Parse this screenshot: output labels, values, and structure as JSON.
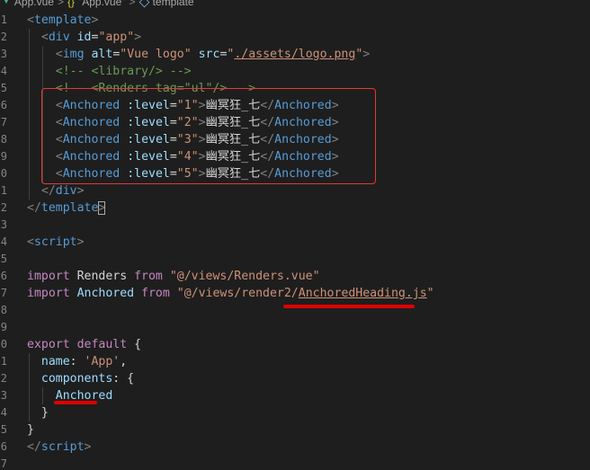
{
  "breadcrumb": {
    "file_icon": "vue-file-icon",
    "file": "App.vue",
    "separator1": ">",
    "braces_icon": "{}",
    "component": "\"App.vue\"",
    "separator2": ">",
    "symbol_icon": "cube-icon",
    "section": "template"
  },
  "colors": {
    "background": "#1e1e1e",
    "tag": "#569cd6",
    "attribute": "#9cdcfe",
    "string": "#ce9178",
    "comment": "#6a9955",
    "keyword": "#c586c0",
    "annotation_red": "#e53935"
  },
  "gutter": {
    "line_numbers": [
      "1",
      "2",
      "3",
      "4",
      "5",
      "6",
      "7",
      "8",
      "9",
      "0",
      "1",
      "2",
      "3",
      "4",
      "5",
      "6",
      "7",
      "8",
      "9",
      "0",
      "1",
      "2",
      "3",
      "4",
      "5",
      "6",
      "7"
    ]
  },
  "code": {
    "l1": {
      "open": "<",
      "tag": "template",
      "close": ">"
    },
    "l2": {
      "open": "<",
      "tag": "div",
      "attr": " id",
      "eq": "=",
      "val": "\"app\"",
      "close": ">"
    },
    "l3": {
      "open": "<",
      "tag": "img",
      "attr1": " alt",
      "eq1": "=",
      "val1": "\"Vue logo\"",
      "attr2": " src",
      "eq2": "=",
      "q1": "\"",
      "path": "./assets/logo.png",
      "q2": "\"",
      "close": ">"
    },
    "l4": {
      "comment": "<!-- <library/> -->"
    },
    "l5": {
      "comment": "<!-- <Renders tag=\"ul\"/> -->"
    },
    "anchored_lines": [
      {
        "open": "<",
        "tag": "Anchored",
        "attr": " :level",
        "eq": "=",
        "val": "\"1\"",
        "close": ">",
        "text": "幽冥狂_七",
        "end_open": "</",
        "end_tag": "Anchored",
        "end_close": ">"
      },
      {
        "open": "<",
        "tag": "Anchored",
        "attr": " :level",
        "eq": "=",
        "val": "\"2\"",
        "close": ">",
        "text": "幽冥狂_七",
        "end_open": "</",
        "end_tag": "Anchored",
        "end_close": ">"
      },
      {
        "open": "<",
        "tag": "Anchored",
        "attr": " :level",
        "eq": "=",
        "val": "\"3\"",
        "close": ">",
        "text": "幽冥狂_七",
        "end_open": "</",
        "end_tag": "Anchored",
        "end_close": ">"
      },
      {
        "open": "<",
        "tag": "Anchored",
        "attr": " :level",
        "eq": "=",
        "val": "\"4\"",
        "close": ">",
        "text": "幽冥狂_七",
        "end_open": "</",
        "end_tag": "Anchored",
        "end_close": ">"
      },
      {
        "open": "<",
        "tag": "Anchored",
        "attr": " :level",
        "eq": "=",
        "val": "\"5\"",
        "close": ">",
        "text": "幽冥狂_七",
        "end_open": "</",
        "end_tag": "Anchored",
        "end_close": ">"
      }
    ],
    "l11": {
      "open": "</",
      "tag": "div",
      "close": ">"
    },
    "l12": {
      "open": "</",
      "tag": "template",
      "close": ">"
    },
    "l14": {
      "open": "<",
      "tag": "script",
      "close": ">"
    },
    "l16": {
      "kw1": "import",
      "name": " Renders ",
      "kw2": "from",
      "path": " \"@/views/Renders.vue\""
    },
    "l17": {
      "kw1": "import",
      "name": " Anchored ",
      "kw2": "from",
      "q1": " \"",
      "path_plain": "@/views/render2/",
      "path_link": "AnchoredHeading.js",
      "q2": "\""
    },
    "l20": {
      "kw1": "export",
      "kw2": " default",
      "brace": " {"
    },
    "l21": {
      "prop": "name",
      "colon": ": ",
      "val": "'App'",
      "comma": ","
    },
    "l22": {
      "prop": "components",
      "rest": ": {"
    },
    "l23": {
      "name": "Anchored"
    },
    "l24": {
      "brace": "}"
    },
    "l25": {
      "brace": "}"
    },
    "l26": {
      "open": "</",
      "tag": "script",
      "close": ">"
    }
  }
}
